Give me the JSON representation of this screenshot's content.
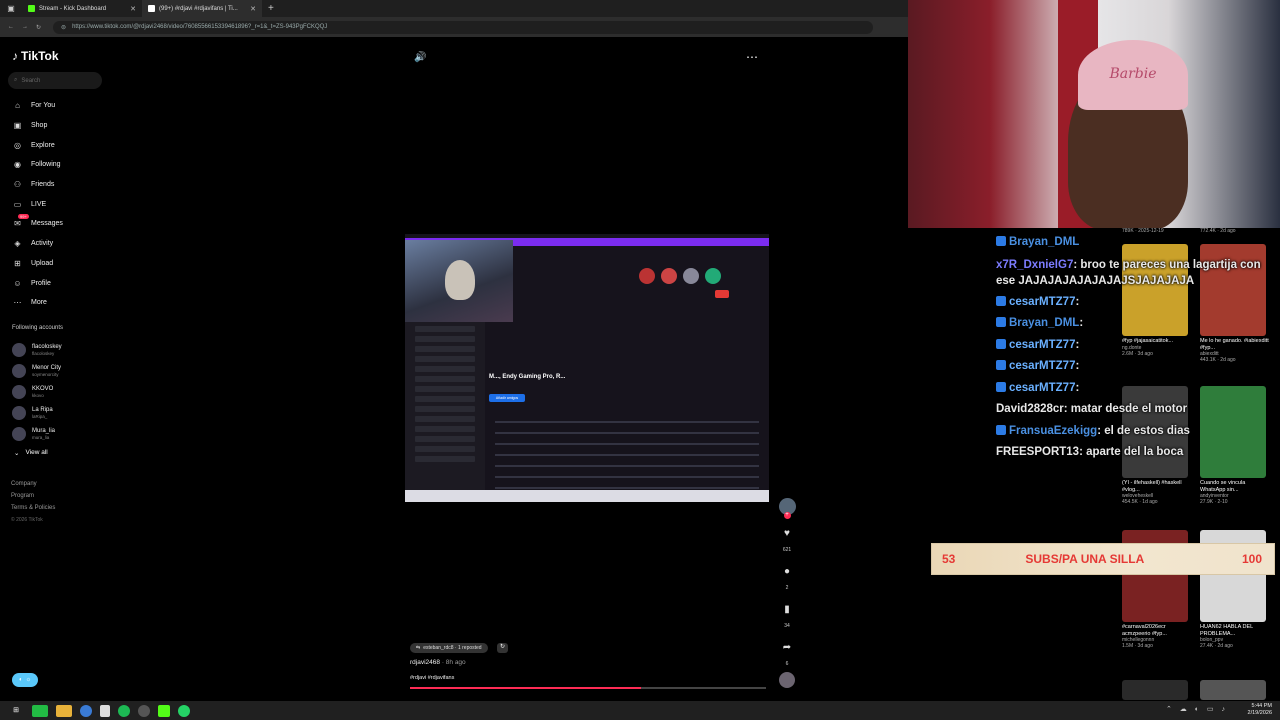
{
  "browser": {
    "tabs": [
      {
        "title": "Stream - Kick Dashboard",
        "color": "#53fc18"
      },
      {
        "title": "(99+) #rdjavi #rdjavifans | Ti...",
        "color": "#ffffff"
      }
    ],
    "url": "https://www.tiktok.com/@rdjavi2468/video/7608556615339461896?_r=1&_t=ZS-943PgFCKQQJ"
  },
  "tiktok": {
    "logo": "TikTok",
    "search_placeholder": "Search",
    "nav": [
      {
        "label": "For You",
        "icon": "home-icon",
        "glyph": "⌂"
      },
      {
        "label": "Shop",
        "icon": "bag-icon",
        "glyph": "▣"
      },
      {
        "label": "Explore",
        "icon": "compass-icon",
        "glyph": "◎"
      },
      {
        "label": "Following",
        "icon": "following-icon",
        "glyph": "◉"
      },
      {
        "label": "Friends",
        "icon": "friends-icon",
        "glyph": "⚇"
      },
      {
        "label": "LIVE",
        "icon": "live-icon",
        "glyph": "▭"
      },
      {
        "label": "Messages",
        "icon": "message-icon",
        "glyph": "✉"
      },
      {
        "label": "Activity",
        "icon": "bell-icon",
        "glyph": "◈"
      },
      {
        "label": "Upload",
        "icon": "upload-icon",
        "glyph": "⊞"
      },
      {
        "label": "Profile",
        "icon": "profile-icon",
        "glyph": "☺"
      },
      {
        "label": "More",
        "icon": "more-icon",
        "glyph": "⋯"
      }
    ],
    "messages_badge": "99+",
    "following_title": "Following accounts",
    "following_accounts": [
      {
        "name": "flacoloskey",
        "handle": "flacoloskey"
      },
      {
        "name": "Menor City",
        "handle": "soymenorcity"
      },
      {
        "name": "KKOVO",
        "handle": "kkovo"
      },
      {
        "name": "La Ripa",
        "handle": "laRipa_"
      },
      {
        "name": "Mura_lia",
        "handle": "mura_lia"
      }
    ],
    "view_all": "View all",
    "footer": [
      "Company",
      "Program",
      "Terms & Policies"
    ],
    "copyright": "© 2026 TikTok"
  },
  "video": {
    "screen_title": "M..., Endy Gaming Pro, R...",
    "screen_button": "Añadir amigos",
    "reposted_by": "esteban_rdc8 · 1 reposted",
    "author": "rdjavi2468",
    "age": "· 8h ago",
    "caption": "#rdjavi #rdjavifans",
    "progress_fraction": 0.65,
    "likes": "621",
    "comments": "2",
    "saves": "34",
    "shares": "6"
  },
  "chat": [
    {
      "user": "Brayan_DML",
      "msg": "",
      "color": "#4a90e2",
      "badge": true
    },
    {
      "user": "x7R_DxnielG7",
      "msg": ": broo te pareces una lagartija con ese JAJAJAJAJAJAJAJSJAJAJAJA",
      "color": "#7c7cff",
      "badge": false,
      "wrap": true
    },
    {
      "user": "cesarMTZ77",
      "msg": ":",
      "color": "#6ab0ff",
      "badge": true
    },
    {
      "user": "Brayan_DML",
      "msg": ":",
      "color": "#4a90e2",
      "badge": true
    },
    {
      "user": "cesarMTZ77",
      "msg": ":",
      "color": "#6ab0ff",
      "badge": true
    },
    {
      "user": "cesarMTZ77",
      "msg": ":",
      "color": "#6ab0ff",
      "badge": true
    },
    {
      "user": "cesarMTZ77",
      "msg": ":",
      "color": "#6ab0ff",
      "badge": true
    },
    {
      "user": "David2828cr",
      "msg": ": matar desde el motor",
      "color": "#e8e8e8",
      "badge": false
    },
    {
      "user": "FransuaEzekigg",
      "msg": ": el de estos dias",
      "color": "#4a90e2",
      "badge": true
    },
    {
      "user": "FREESPORT13",
      "msg": ": aparte del la boca",
      "color": "#e8e8e8",
      "badge": false
    }
  ],
  "thumbnails": [
    {
      "title": "#fyp #jajasaicatitok...",
      "meta1": "ng.donte",
      "meta2": "2.6M · 3d ago",
      "bg": "#caa12a"
    },
    {
      "title": "Me lo he ganado. #iabiexditt #fyp...",
      "meta1": "abiexditt",
      "meta2": "443.1K · 2d ago",
      "bg": "#a33b2e"
    },
    {
      "title": "(YI - ilfehaskell) #haskell #vlog...",
      "meta1": "weloveheskell",
      "meta2": "454.5K · 1d ago",
      "bg": "#3a3a3a"
    },
    {
      "title": "Cuando se vincula WhatsApp sin...",
      "meta1": "andyinventor",
      "meta2": "27.9K · 2-10",
      "bg": "#2f7d3b"
    },
    {
      "title": "#carnaval2026ecr acmzpeerio #fyp...",
      "meta1": "michellegonnn",
      "meta2": "1.5M · 3d ago",
      "bg": "#7a2222"
    },
    {
      "title": "HUAN62 HABLA DEL PROBLEMA...",
      "meta1": "bolon_ppv",
      "meta2": "27.4K · 2d ago",
      "bg": "#d8d8d8"
    }
  ],
  "thumb_top_meta": [
    "789K · 2025-12-19",
    "772.4K · 2d ago"
  ],
  "goal": {
    "current": "53",
    "label": "SUBS/PA UNA SILLA",
    "target": "100"
  },
  "webcam": {
    "cap_text": "Barbie"
  },
  "taskbar": {
    "time": "5:44 PM",
    "date": "2/19/2026"
  }
}
